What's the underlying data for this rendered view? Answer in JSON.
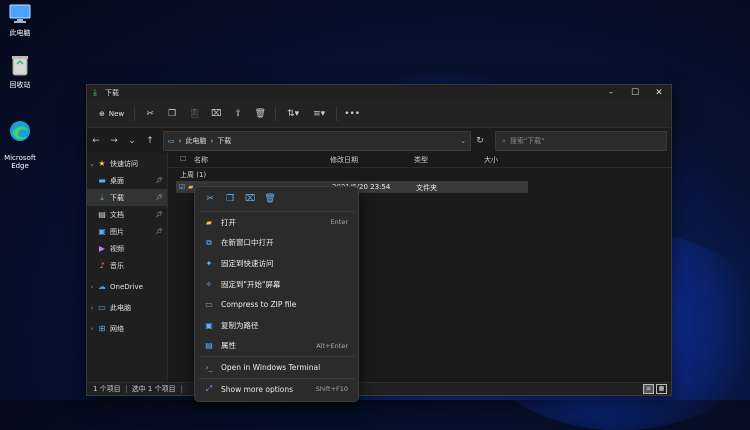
{
  "desktop": {
    "icons": [
      {
        "label": "此电脑",
        "icon": "computer-icon"
      },
      {
        "label": "回收站",
        "icon": "recycle-bin-icon"
      },
      {
        "label": "Microsoft\nEdge",
        "icon": "edge-icon"
      }
    ]
  },
  "window": {
    "title": "下载",
    "toolbar": {
      "new_label": "New",
      "icons": [
        "cut-icon",
        "copy-icon",
        "paste-icon",
        "rename-icon",
        "share-icon",
        "delete-icon",
        "sort-icon",
        "view-icon",
        "more-icon"
      ]
    },
    "address": {
      "crumbs": [
        "此电脑",
        "下载"
      ],
      "search_placeholder": "搜索\"下载\""
    },
    "sidebar": {
      "items": [
        {
          "label": "快速访问",
          "icon": "star-icon",
          "expand": "v",
          "pinned": false
        },
        {
          "label": "桌面",
          "icon": "desktop-icon",
          "expand": "",
          "pinned": true
        },
        {
          "label": "下载",
          "icon": "download-icon",
          "expand": "",
          "pinned": true
        },
        {
          "label": "文档",
          "icon": "document-icon",
          "expand": "",
          "pinned": true
        },
        {
          "label": "图片",
          "icon": "picture-icon",
          "expand": "",
          "pinned": true
        },
        {
          "label": "视频",
          "icon": "video-icon",
          "expand": "",
          "pinned": false
        },
        {
          "label": "音乐",
          "icon": "music-icon",
          "expand": "",
          "pinned": false
        },
        {
          "label": "OneDrive",
          "icon": "cloud-icon",
          "expand": ">",
          "pinned": false
        },
        {
          "label": "此电脑",
          "icon": "computer-icon",
          "expand": ">",
          "pinned": false
        },
        {
          "label": "网络",
          "icon": "network-icon",
          "expand": ">",
          "pinned": false
        }
      ]
    },
    "columns": {
      "name": "名称",
      "modified": "修改日期",
      "type": "类型",
      "size": "大小"
    },
    "group_label": "上周 (1)",
    "row": {
      "name": "",
      "modified": "2021/6/20 23:54",
      "type": "文件夹"
    },
    "status": {
      "count": "1 个项目",
      "selected": "选中 1 个项目"
    }
  },
  "context_menu": {
    "top_icons": [
      "cut-icon",
      "copy-icon",
      "rename-icon",
      "delete-icon"
    ],
    "items": [
      {
        "label": "打开",
        "shortcut": "Enter",
        "icon": "folder-icon"
      },
      {
        "label": "在新窗口中打开",
        "shortcut": "",
        "icon": "new-window-icon"
      },
      {
        "label": "固定到快速访问",
        "shortcut": "",
        "icon": "pin-icon"
      },
      {
        "label": "固定到\"开始\"屏幕",
        "shortcut": "",
        "icon": "pin-start-icon"
      },
      {
        "label": "Compress to ZIP file",
        "shortcut": "",
        "icon": "zip-icon"
      },
      {
        "label": "复制为路径",
        "shortcut": "",
        "icon": "copy-path-icon"
      },
      {
        "label": "属性",
        "shortcut": "Alt+Enter",
        "icon": "properties-icon"
      },
      {
        "label": "Open in Windows Terminal",
        "shortcut": "",
        "icon": "terminal-icon"
      },
      {
        "label": "Show more options",
        "shortcut": "Shift+F10",
        "icon": "more-options-icon"
      }
    ]
  }
}
